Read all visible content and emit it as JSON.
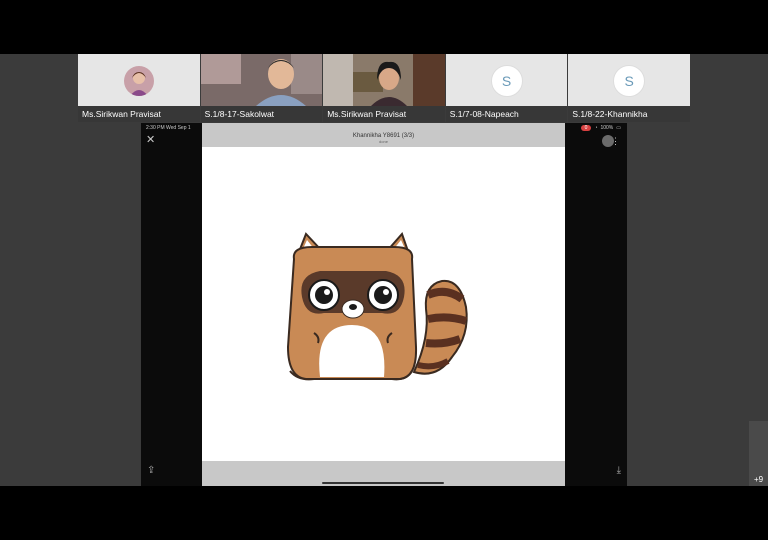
{
  "participants": [
    {
      "name": "Ms.Sirikwan Pravisat",
      "type": "avatar-photo"
    },
    {
      "name": "S.1/8-17-Sakolwat",
      "type": "video"
    },
    {
      "name": "Ms.Sirikwan Pravisat",
      "type": "video"
    },
    {
      "name": "S.1/7-08-Napeach",
      "type": "initial",
      "initial": "S"
    },
    {
      "name": "S.1/8-22-Khannikha",
      "type": "initial",
      "initial": "S"
    }
  ],
  "share": {
    "status_time": "2:30 PM  Wed Sep 1",
    "battery": "100%",
    "rec_label": "0",
    "viewer_title": "Khannikha Y8691 (3/3)",
    "viewer_subtitle": "done"
  },
  "more_participants": "+9",
  "colors": {
    "accent": "#6a9ab8",
    "raccoon_fur": "#c98a55",
    "record": "#d94141"
  }
}
